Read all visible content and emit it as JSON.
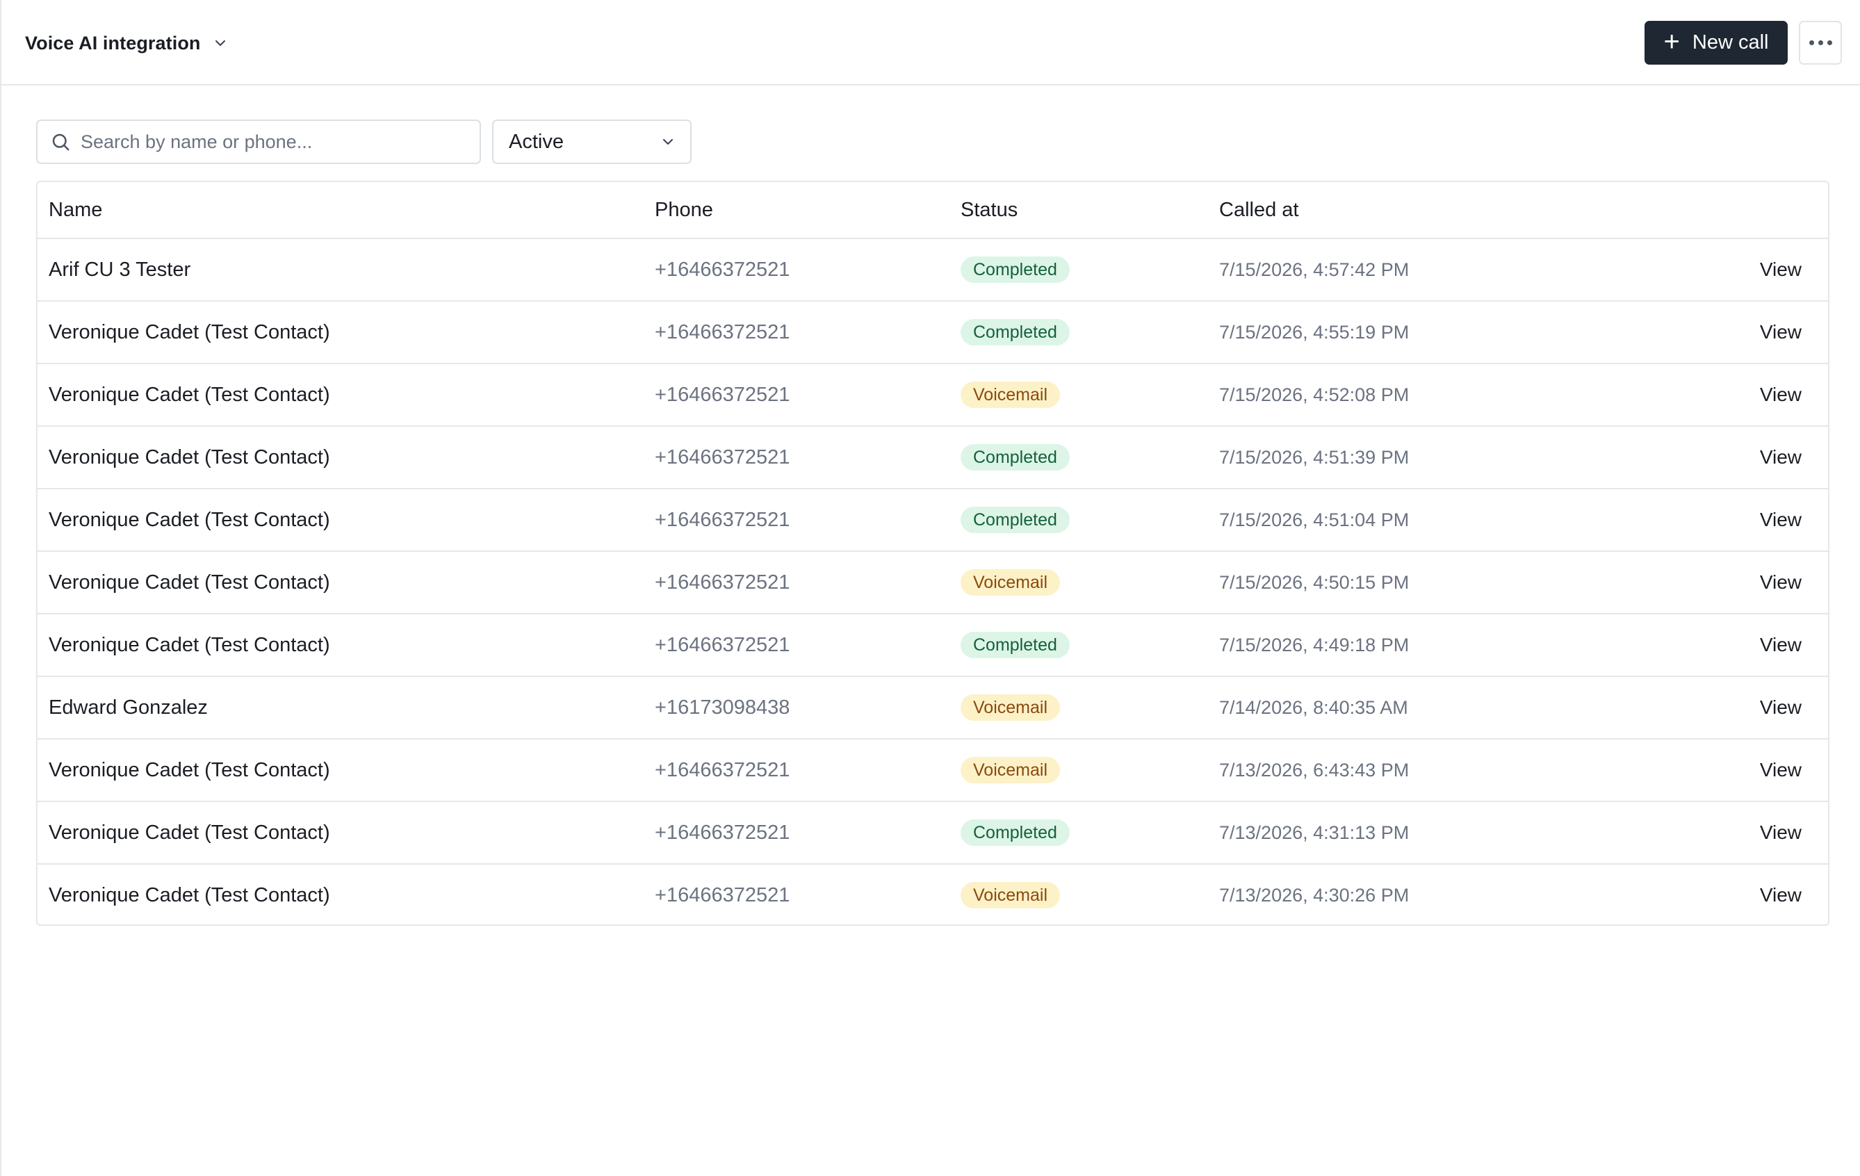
{
  "header": {
    "project_title": "Voice AI integration",
    "new_call_label": "New call"
  },
  "filters": {
    "search_placeholder": "Search by name or phone...",
    "status_value": "Active"
  },
  "table": {
    "columns": [
      "Name",
      "Phone",
      "Status",
      "Called at"
    ],
    "view_label": "View",
    "rows": [
      {
        "name": "Arif CU 3 Tester",
        "phone": "+16466372521",
        "status": "Completed",
        "called_at": "7/15/2026, 4:57:42 PM"
      },
      {
        "name": "Veronique Cadet (Test Contact)",
        "phone": "+16466372521",
        "status": "Completed",
        "called_at": "7/15/2026, 4:55:19 PM"
      },
      {
        "name": "Veronique Cadet (Test Contact)",
        "phone": "+16466372521",
        "status": "Voicemail",
        "called_at": "7/15/2026, 4:52:08 PM"
      },
      {
        "name": "Veronique Cadet (Test Contact)",
        "phone": "+16466372521",
        "status": "Completed",
        "called_at": "7/15/2026, 4:51:39 PM"
      },
      {
        "name": "Veronique Cadet (Test Contact)",
        "phone": "+16466372521",
        "status": "Completed",
        "called_at": "7/15/2026, 4:51:04 PM"
      },
      {
        "name": "Veronique Cadet (Test Contact)",
        "phone": "+16466372521",
        "status": "Voicemail",
        "called_at": "7/15/2026, 4:50:15 PM"
      },
      {
        "name": "Veronique Cadet (Test Contact)",
        "phone": "+16466372521",
        "status": "Completed",
        "called_at": "7/15/2026, 4:49:18 PM"
      },
      {
        "name": "Edward Gonzalez",
        "phone": "+16173098438",
        "status": "Voicemail",
        "called_at": "7/14/2026, 8:40:35 AM"
      },
      {
        "name": "Veronique Cadet (Test Contact)",
        "phone": "+16466372521",
        "status": "Voicemail",
        "called_at": "7/13/2026, 6:43:43 PM"
      },
      {
        "name": "Veronique Cadet (Test Contact)",
        "phone": "+16466372521",
        "status": "Completed",
        "called_at": "7/13/2026, 4:31:13 PM"
      },
      {
        "name": "Veronique Cadet (Test Contact)",
        "phone": "+16466372521",
        "status": "Voicemail",
        "called_at": "7/13/2026, 4:30:26 PM"
      }
    ]
  },
  "icons": {
    "project_dropdown": "chevron-down-icon",
    "new_call": "plus-icon",
    "more": "more-horizontal-icon",
    "search": "search-icon",
    "status_dropdown": "chevron-down-icon"
  },
  "colors": {
    "primary_button": "#1e2732",
    "completed_bg": "#dcf5e7",
    "completed_text": "#16603b",
    "voicemail_bg": "#fdf1c8",
    "voicemail_text": "#8a4a0c"
  }
}
